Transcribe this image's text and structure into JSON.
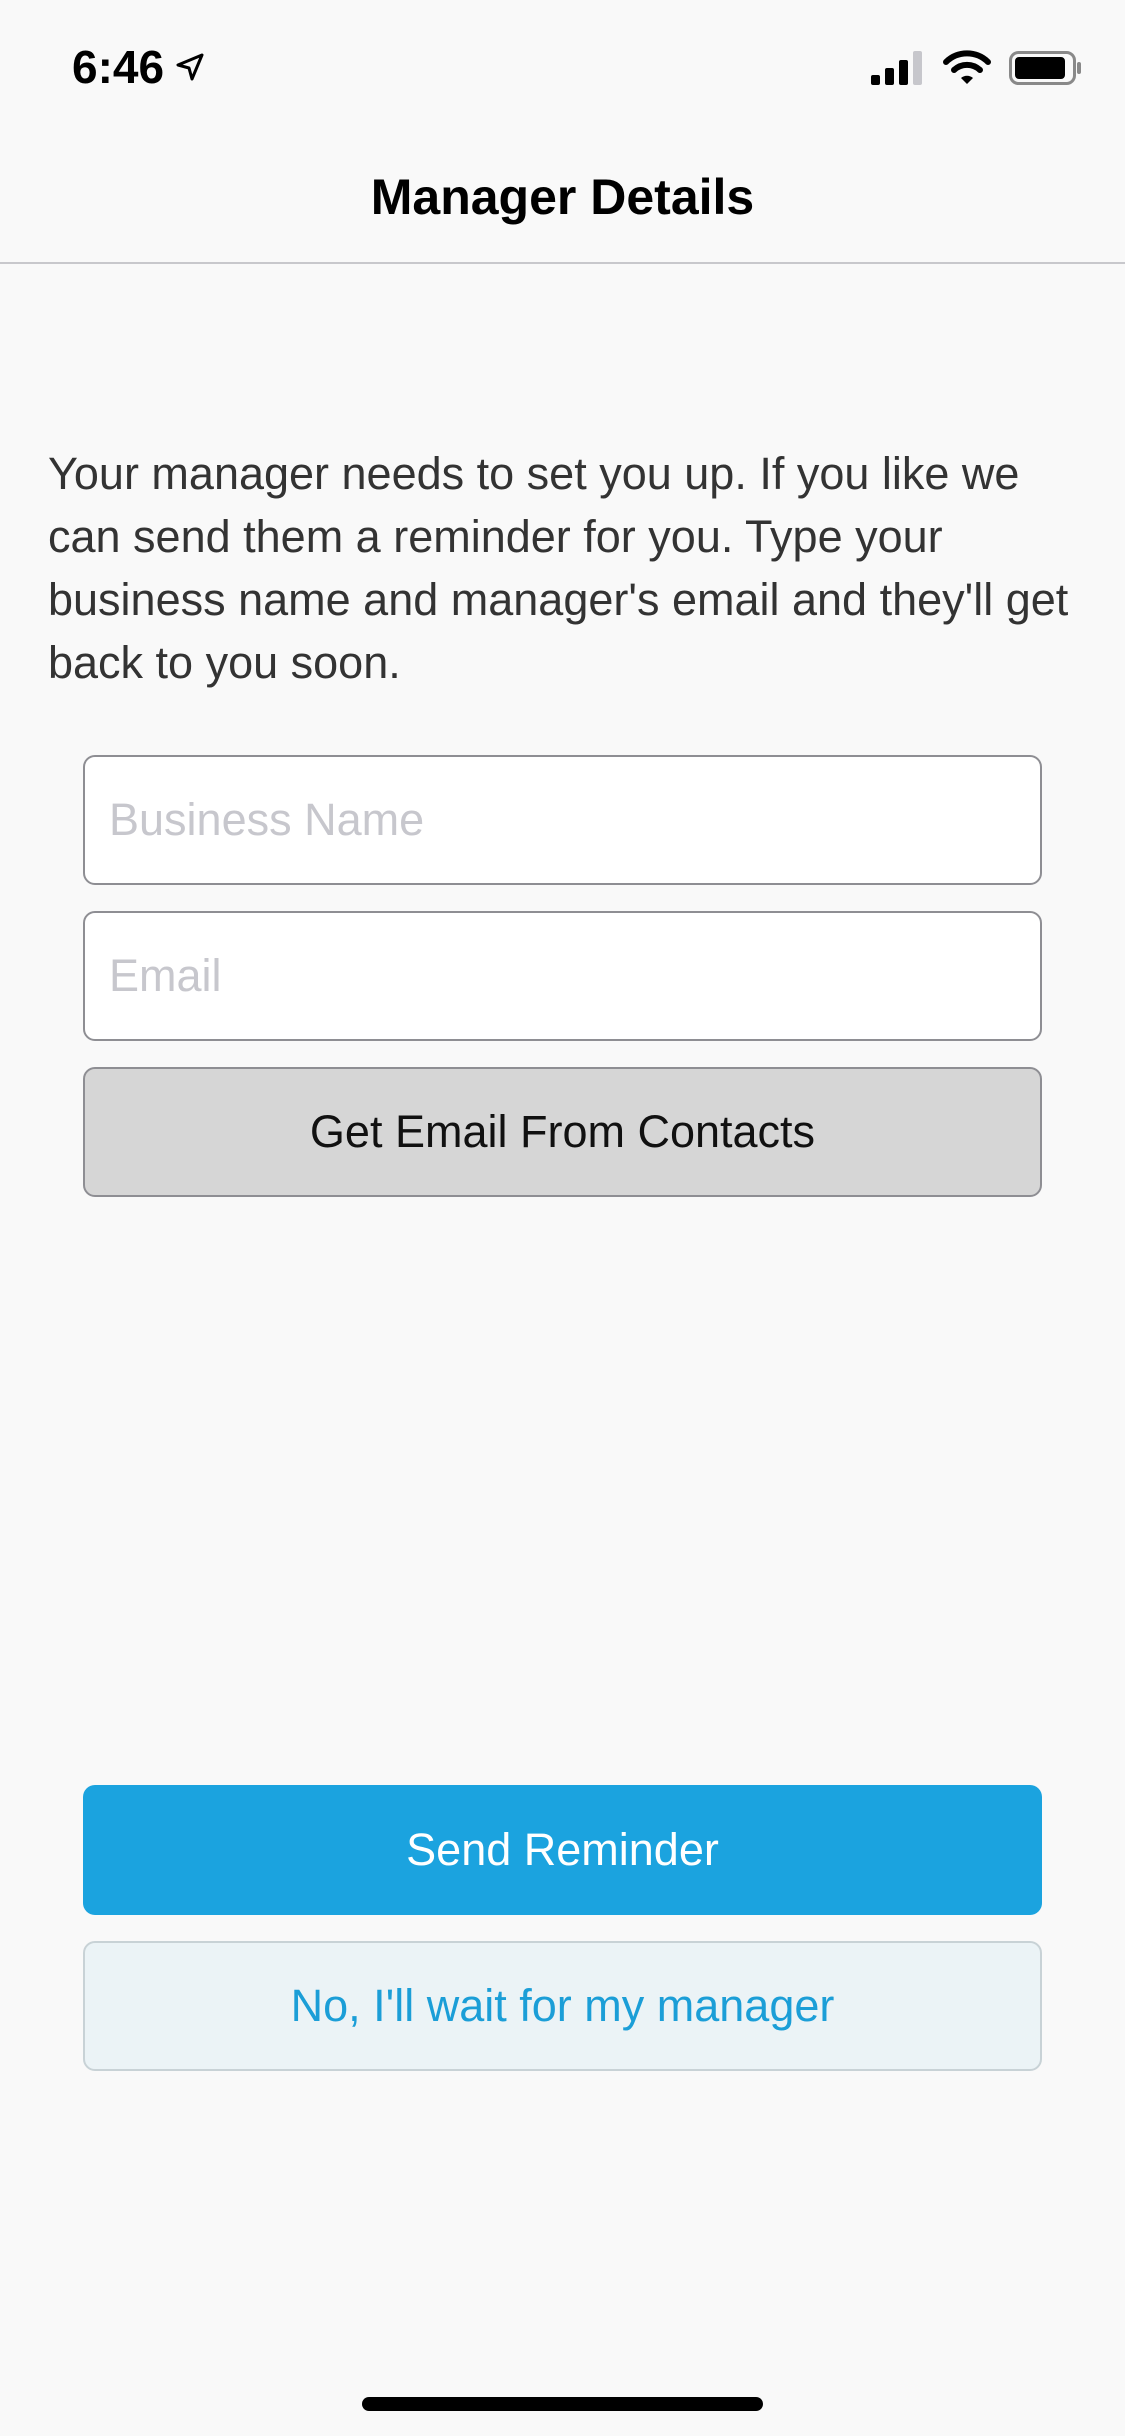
{
  "status_bar": {
    "time": "6:46",
    "icons": [
      "location-arrow-icon",
      "cellular-signal-icon",
      "wifi-icon",
      "battery-icon"
    ]
  },
  "nav": {
    "title": "Manager Details"
  },
  "intro_text": "Your manager needs to set you up. If you like we can send them a reminder for you. Type your business name and manager's email and they'll get back to you soon.",
  "form": {
    "business_name": {
      "value": "",
      "placeholder": "Business Name"
    },
    "email": {
      "value": "",
      "placeholder": "Email"
    },
    "contacts_button_label": "Get Email From Contacts"
  },
  "actions": {
    "send_label": "Send Reminder",
    "wait_label": "No, I'll wait for my manager"
  },
  "colors": {
    "background": "#f9f9f9",
    "primary": "#1ba3df",
    "secondary_bg": "#ebf3f6",
    "contacts_bg": "#d6d6d6",
    "text": "#333333",
    "placeholder": "#c7c7cd"
  }
}
